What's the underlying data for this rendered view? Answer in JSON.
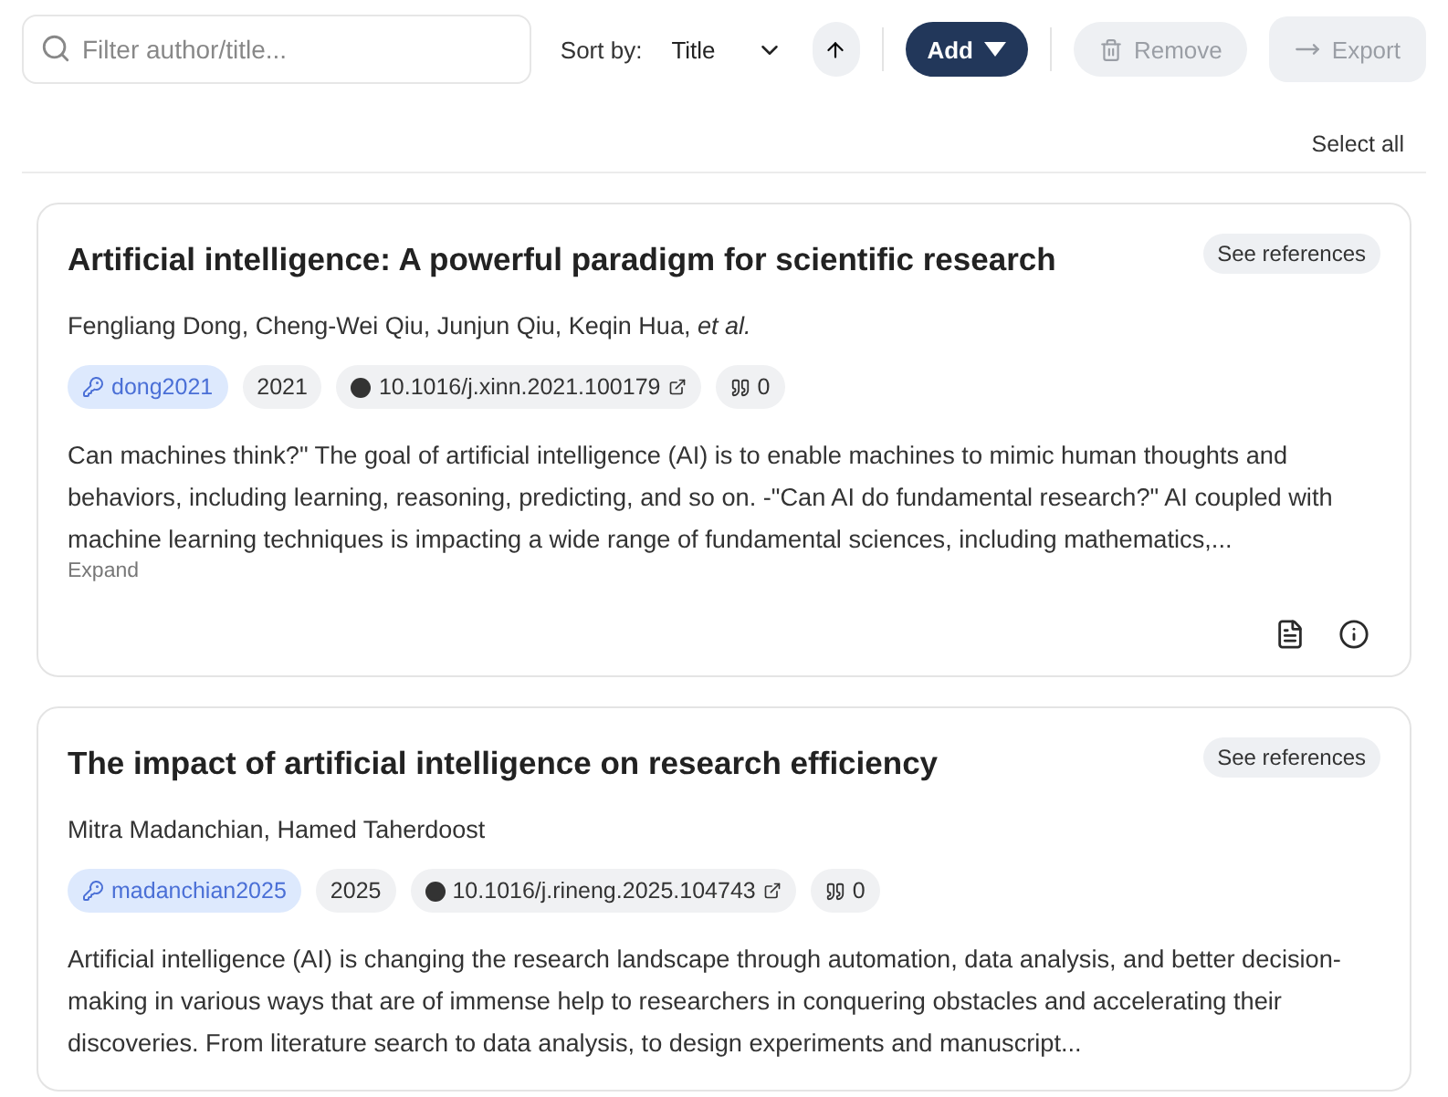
{
  "toolbar": {
    "search": {
      "placeholder": "Filter author/title..."
    },
    "sort_label": "Sort by:",
    "sort_value": "Title",
    "sort_ascending": true,
    "buttons": [
      {
        "label": "Add",
        "kind": "add",
        "disabled": false
      },
      {
        "label": "Remove",
        "kind": "remove",
        "disabled": true
      },
      {
        "label": "Export",
        "kind": "export",
        "disabled": true
      }
    ]
  },
  "select_all": "Select all",
  "entries": [
    {
      "title": "Artificial intelligence: A powerful paradigm for scientific research",
      "authors": "Fengliang Dong, Cheng-Wei Qiu, Junjun Qiu, Keqin Hua, *et al.*",
      "see_references": "See references",
      "key": "dong2021",
      "year": "2021",
      "doi": "10.1016/j.xinn.2021.100179",
      "citations": "0",
      "abstract": "Can machines think?\" The goal of artificial intelligence (AI) is to enable machines to mimic human thoughts and behaviors, including learning, reasoning, predicting, and so on. -\"Can AI do fundamental research?\" AI coupled with machine learning techniques is impacting a wide range of fundamental sciences, including mathematics,...",
      "expand": "Expand"
    },
    {
      "title": "The impact of artificial intelligence on research efficiency",
      "authors": "Mitra Madanchian, Hamed Taherdoost",
      "see_references": "See references",
      "key": "madanchian2025",
      "year": "2025",
      "doi": "10.1016/j.rineng.2025.104743",
      "citations": "0",
      "abstract": "Artificial intelligence (AI) is changing the research landscape through automation, data analysis, and better decision-making in various ways that are of immense help to researchers in conquering obstacles and accelerating their discoveries. From literature search to data analysis, to design experiments and manuscript..."
    }
  ]
}
